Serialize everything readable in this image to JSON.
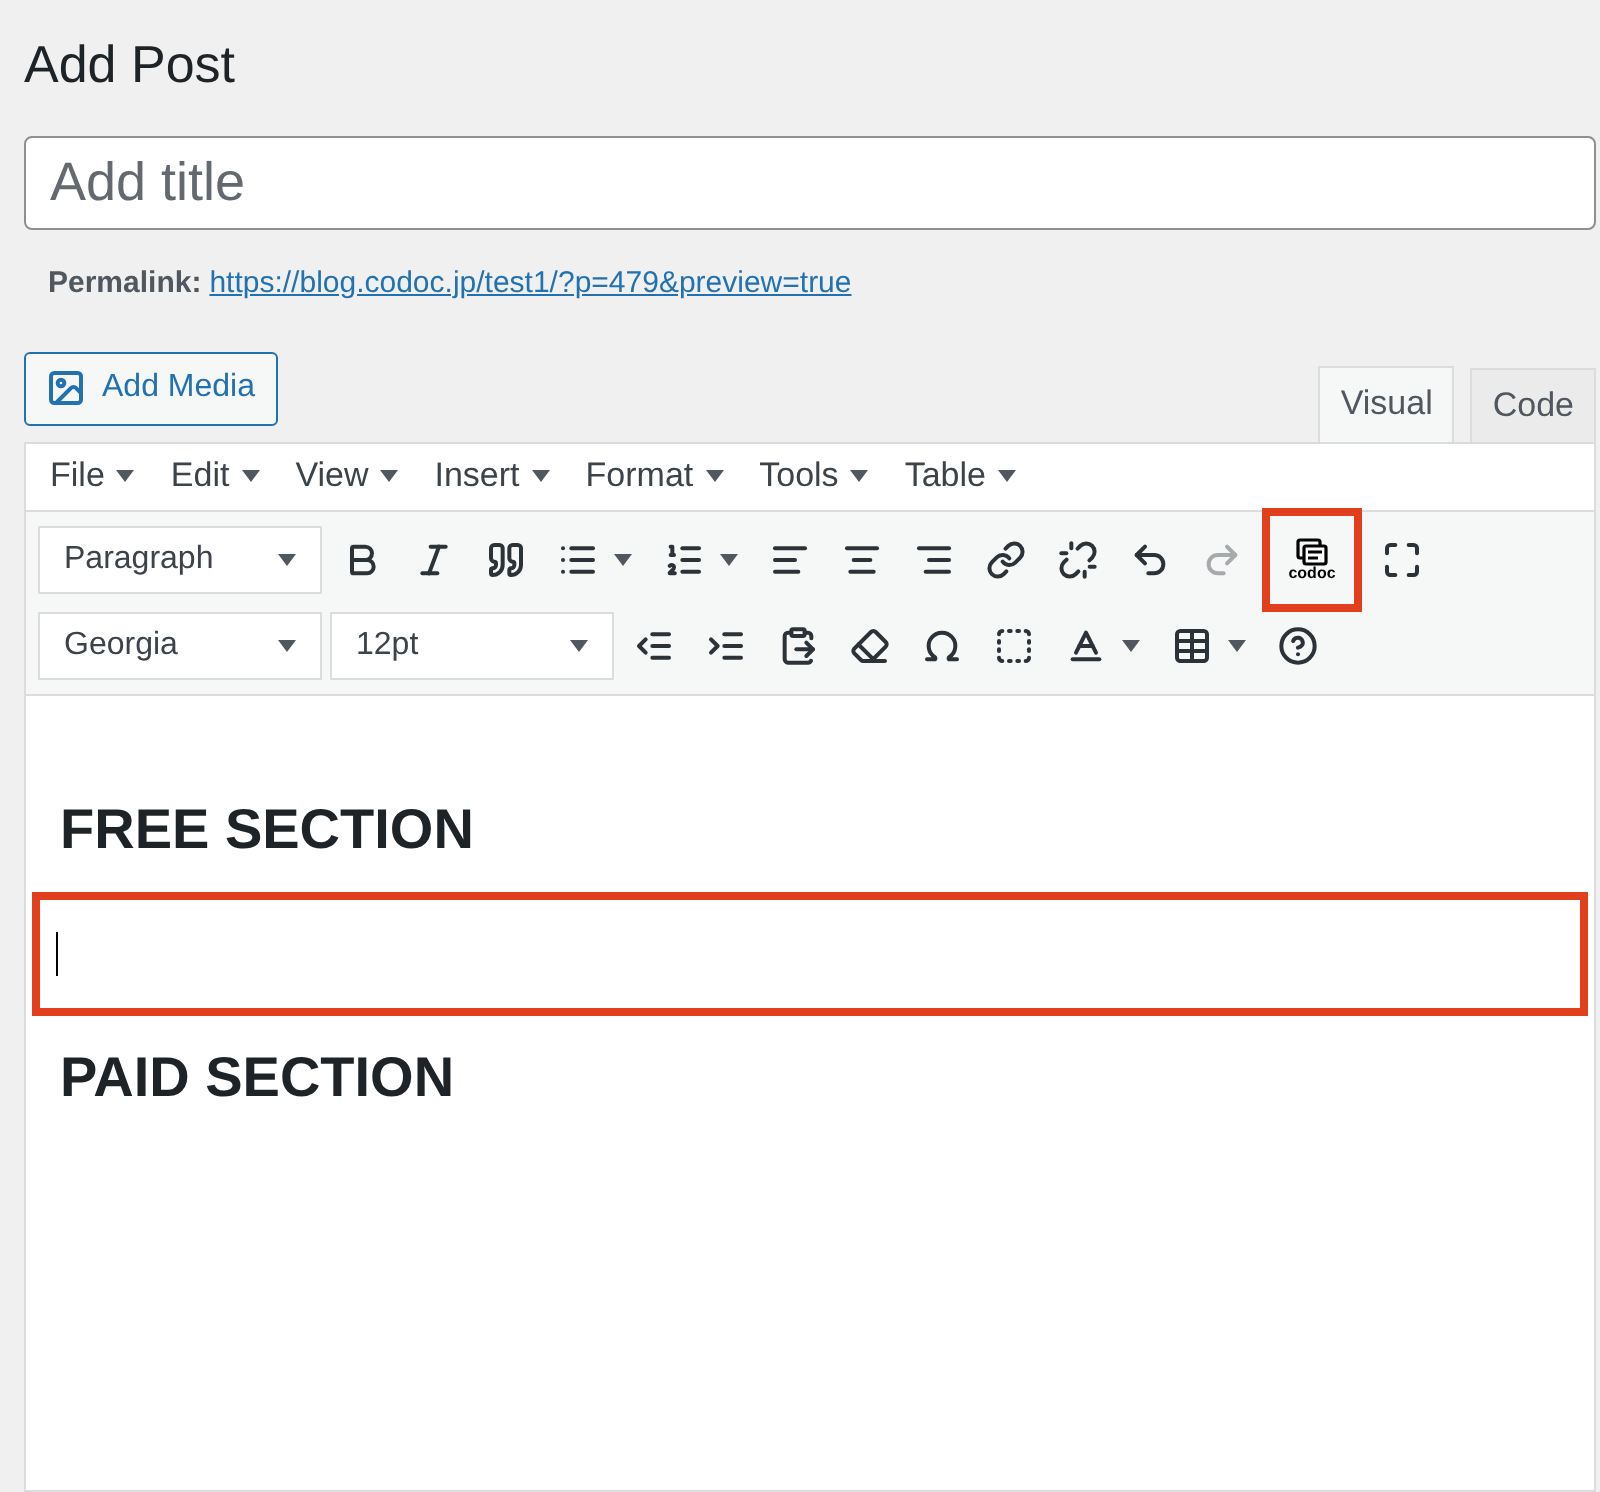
{
  "page_title": "Add Post",
  "title_field": {
    "placeholder": "Add title"
  },
  "permalink": {
    "label": "Permalink:",
    "url": "https://blog.codoc.jp/test1/?p=479&preview=true"
  },
  "add_media": "Add Media",
  "editor_tabs": [
    {
      "label": "Visual",
      "selected": true
    },
    {
      "label": "Code",
      "selected": false
    }
  ],
  "menu": [
    "File",
    "Edit",
    "View",
    "Insert",
    "Format",
    "Tools",
    "Table"
  ],
  "toolbar_rows": [
    [
      {
        "kind": "select",
        "value": "Paragraph"
      },
      {
        "kind": "button",
        "disabled": false,
        "highlighted": false
      },
      {
        "kind": "button",
        "disabled": false,
        "highlighted": false
      },
      {
        "kind": "button",
        "disabled": false,
        "highlighted": false
      },
      {
        "kind": "split",
        "disabled": false,
        "highlighted": false
      },
      {
        "kind": "split",
        "disabled": false,
        "highlighted": false
      },
      {
        "kind": "button",
        "disabled": false,
        "highlighted": false
      },
      {
        "kind": "button",
        "disabled": false,
        "highlighted": false
      },
      {
        "kind": "button",
        "disabled": false,
        "highlighted": false
      },
      {
        "kind": "button",
        "disabled": false,
        "highlighted": false
      },
      {
        "kind": "button",
        "disabled": false,
        "highlighted": false
      },
      {
        "kind": "button",
        "disabled": false,
        "highlighted": false
      },
      {
        "kind": "button",
        "disabled": true,
        "highlighted": false
      },
      {
        "kind": "labeled",
        "label": "codoc",
        "disabled": false,
        "highlighted": true
      },
      {
        "kind": "button",
        "disabled": false,
        "highlighted": false
      }
    ],
    [
      {
        "kind": "select",
        "value": "Georgia"
      },
      {
        "kind": "select",
        "value": "12pt"
      },
      {
        "kind": "button",
        "disabled": false,
        "highlighted": false
      },
      {
        "kind": "button",
        "disabled": false,
        "highlighted": false
      },
      {
        "kind": "button",
        "disabled": false,
        "highlighted": false
      },
      {
        "kind": "button",
        "disabled": false,
        "highlighted": false
      },
      {
        "kind": "button",
        "disabled": false,
        "highlighted": false
      },
      {
        "kind": "button",
        "disabled": false,
        "highlighted": false
      },
      {
        "kind": "split",
        "disabled": false,
        "highlighted": false
      },
      {
        "kind": "split",
        "disabled": false,
        "highlighted": false
      },
      {
        "kind": "button",
        "disabled": false,
        "highlighted": false
      }
    ]
  ],
  "content": [
    {
      "kind": "heading",
      "text": "FREE SECTION",
      "highlighted": false
    },
    {
      "kind": "cursor",
      "highlighted": true
    },
    {
      "kind": "heading",
      "text": "PAID SECTION",
      "highlighted": false
    }
  ]
}
